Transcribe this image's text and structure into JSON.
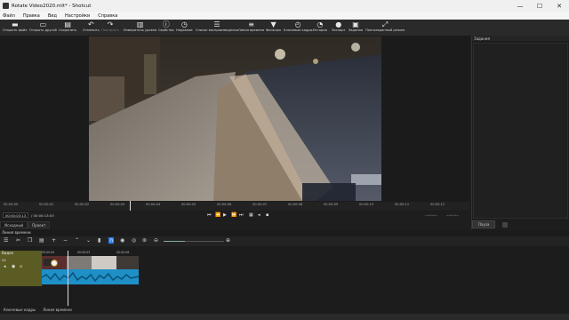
{
  "window": {
    "title": "Rotate Video2020.mlt* - Shotcut",
    "minimize": "—",
    "maximize": "☐",
    "close": "✕"
  },
  "menu": [
    "Файл",
    "Правка",
    "Вид",
    "Настройки",
    "Справка"
  ],
  "toolbar": [
    {
      "label": "Открыть файл",
      "icon": "folder-icon"
    },
    {
      "label": "Открыть другой",
      "icon": "open-other-icon"
    },
    {
      "label": "Сохранить",
      "icon": "save-icon"
    },
    {
      "label": "Отменить",
      "icon": "undo-icon"
    },
    {
      "label": "Повторить",
      "icon": "redo-icon"
    },
    {
      "label": "Измеритель уровня",
      "icon": "meter-icon"
    },
    {
      "label": "Свойства",
      "icon": "properties-icon"
    },
    {
      "label": "Недавние",
      "icon": "recent-icon"
    },
    {
      "label": "Список воспроизведения",
      "icon": "playlist-icon"
    },
    {
      "label": "Линия времени",
      "icon": "timeline-icon"
    },
    {
      "label": "Фильтры",
      "icon": "filter-icon"
    },
    {
      "label": "Ключевые кадры",
      "icon": "keyframes-icon"
    },
    {
      "label": "История",
      "icon": "history-icon"
    },
    {
      "label": "Экспорт",
      "icon": "export-icon"
    },
    {
      "label": "Задания",
      "icon": "jobs-icon"
    },
    {
      "label": "Полноэкранный режим",
      "icon": "fullscreen-icon"
    }
  ],
  "right_panel": {
    "title": "Задания",
    "pause_label": "Пауза"
  },
  "ruler": [
    "00:00:00",
    "00:00:01",
    "00:00:02",
    "00:00:03",
    "00:00:04",
    "00:00:05",
    "00:00:06",
    "00:00:07",
    "00:00:08",
    "00:00:09",
    "00:00:10",
    "00:00:11",
    "00:00:12"
  ],
  "transport": {
    "position": "00:00:03:13",
    "duration": "/ 00:00:13:03",
    "in_point": "--:--:--:--",
    "out_point": "--:--:--:--"
  },
  "player_tabs": [
    "Исходный",
    "Проект"
  ],
  "timeline": {
    "label": "Линия времени",
    "track_name": "Видео",
    "track_id": "V1",
    "ruler": [
      "00:00:00",
      "00:00:03",
      "00:00:06"
    ]
  },
  "bottom_tabs": [
    "Ключевые кадры",
    "Линия времени"
  ],
  "colors": {
    "track_header": "#5b5b24",
    "clip": "#1e90c7",
    "accent": "#2a7fff"
  }
}
